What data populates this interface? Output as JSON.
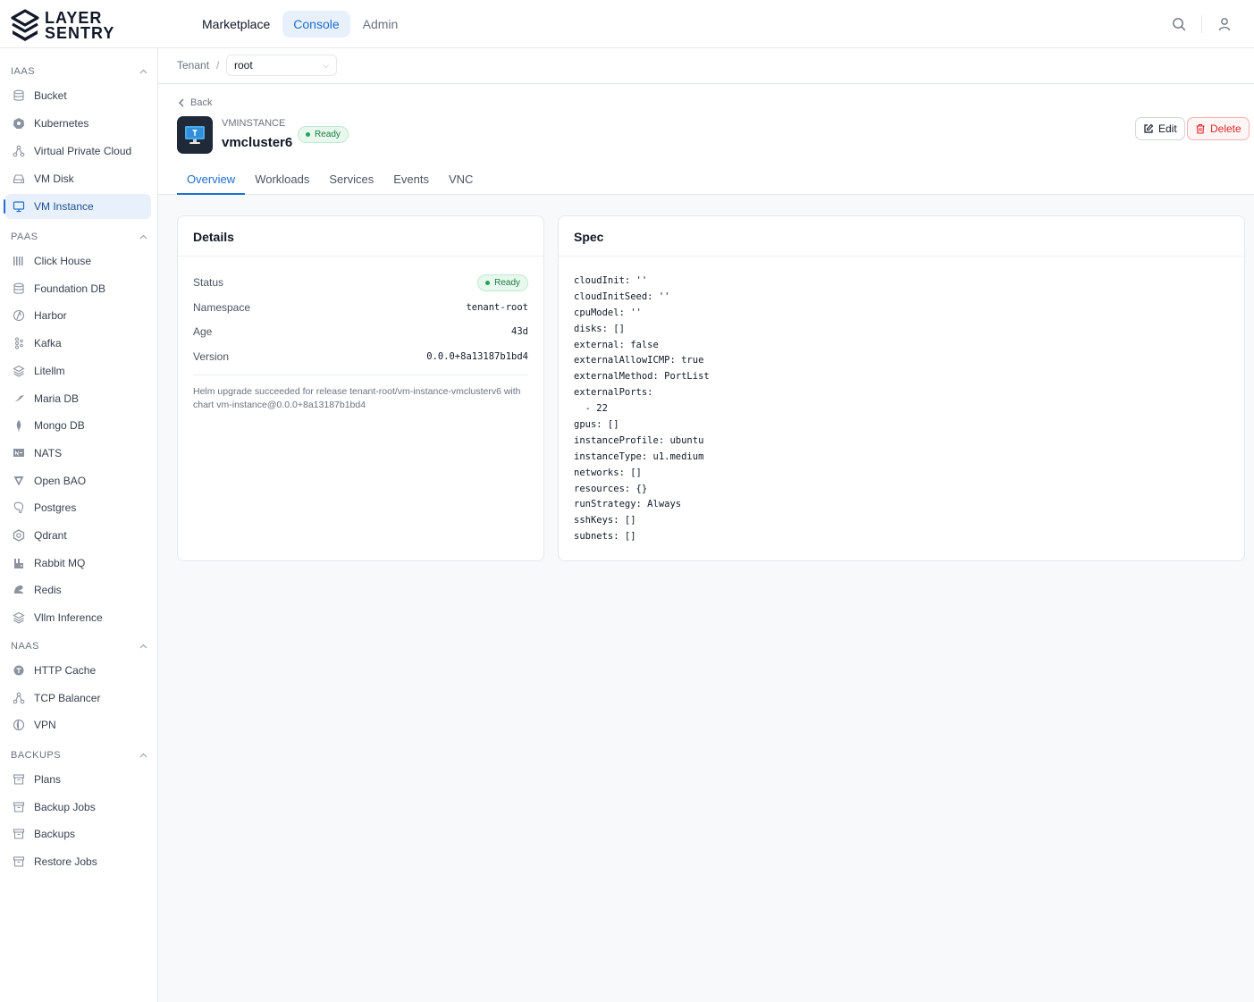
{
  "brand": {
    "line1": "LAYER",
    "line2": "SENTRY"
  },
  "topnav": [
    {
      "label": "Marketplace"
    },
    {
      "label": "Console"
    },
    {
      "label": "Admin"
    }
  ],
  "sidebar": {
    "sections": [
      {
        "title": "IAAS",
        "items": [
          {
            "label": "Bucket",
            "icon": "database-icon"
          },
          {
            "label": "Kubernetes",
            "icon": "kubernetes-icon"
          },
          {
            "label": "Virtual Private Cloud",
            "icon": "network-icon"
          },
          {
            "label": "VM Disk",
            "icon": "disk-icon"
          },
          {
            "label": "VM Instance",
            "icon": "monitor-icon"
          }
        ]
      },
      {
        "title": "PAAS",
        "items": [
          {
            "label": "Click House",
            "icon": "columns-icon"
          },
          {
            "label": "Foundation DB",
            "icon": "database-icon"
          },
          {
            "label": "Harbor",
            "icon": "harbor-icon"
          },
          {
            "label": "Kafka",
            "icon": "kafka-icon"
          },
          {
            "label": "Litellm",
            "icon": "layers-icon"
          },
          {
            "label": "Maria DB",
            "icon": "seal-icon"
          },
          {
            "label": "Mongo DB",
            "icon": "leaf-icon"
          },
          {
            "label": "NATS",
            "icon": "nats-icon"
          },
          {
            "label": "Open BAO",
            "icon": "triangle-icon"
          },
          {
            "label": "Postgres",
            "icon": "elephant-icon"
          },
          {
            "label": "Qdrant",
            "icon": "hexagon-icon"
          },
          {
            "label": "Rabbit MQ",
            "icon": "rabbit-icon"
          },
          {
            "label": "Redis",
            "icon": "redis-icon"
          },
          {
            "label": "Vllm Inference",
            "icon": "layers-icon"
          }
        ]
      },
      {
        "title": "NAAS",
        "items": [
          {
            "label": "HTTP Cache",
            "icon": "cache-icon"
          },
          {
            "label": "TCP Balancer",
            "icon": "network-icon"
          },
          {
            "label": "VPN",
            "icon": "vpn-icon"
          }
        ]
      },
      {
        "title": "BACKUPS",
        "items": [
          {
            "label": "Plans",
            "icon": "archive-icon"
          },
          {
            "label": "Backup Jobs",
            "icon": "archive-icon"
          },
          {
            "label": "Backups",
            "icon": "archive-icon"
          },
          {
            "label": "Restore Jobs",
            "icon": "archive-icon"
          }
        ]
      }
    ]
  },
  "breadcrumb": {
    "label": "Tenant",
    "separator": "/",
    "selected": "root"
  },
  "header": {
    "back_label": "Back",
    "kind": "VMINSTANCE",
    "name": "vmcluster6",
    "status": "Ready",
    "edit_label": "Edit",
    "delete_label": "Delete"
  },
  "tabs": [
    {
      "label": "Overview"
    },
    {
      "label": "Workloads"
    },
    {
      "label": "Services"
    },
    {
      "label": "Events"
    },
    {
      "label": "VNC"
    }
  ],
  "details": {
    "title": "Details",
    "rows": [
      {
        "label": "Status",
        "value": "Ready"
      },
      {
        "label": "Namespace",
        "value": "tenant-root"
      },
      {
        "label": "Age",
        "value": "43d"
      },
      {
        "label": "Version",
        "value": "0.0.0+8a13187b1bd4"
      }
    ],
    "message": "Helm upgrade succeeded for release tenant-root/vm-instance-vmclusterv6 with chart vm-instance@0.0.0+8a13187b1bd4"
  },
  "spec": {
    "title": "Spec",
    "lines": [
      "cloudInit: ''",
      "cloudInitSeed: ''",
      "cpuModel: ''",
      "disks: []",
      "external: false",
      "externalAllowICMP: true",
      "externalMethod: PortList",
      "externalPorts:",
      "  - 22",
      "gpus: []",
      "instanceProfile: ubuntu",
      "instanceType: u1.medium",
      "networks: []",
      "resources: {}",
      "runStrategy: Always",
      "sshKeys: []",
      "subnets: []"
    ]
  },
  "colors": {
    "accent": "#1d6fd1",
    "success": "#15803d",
    "danger": "#dc2626"
  }
}
